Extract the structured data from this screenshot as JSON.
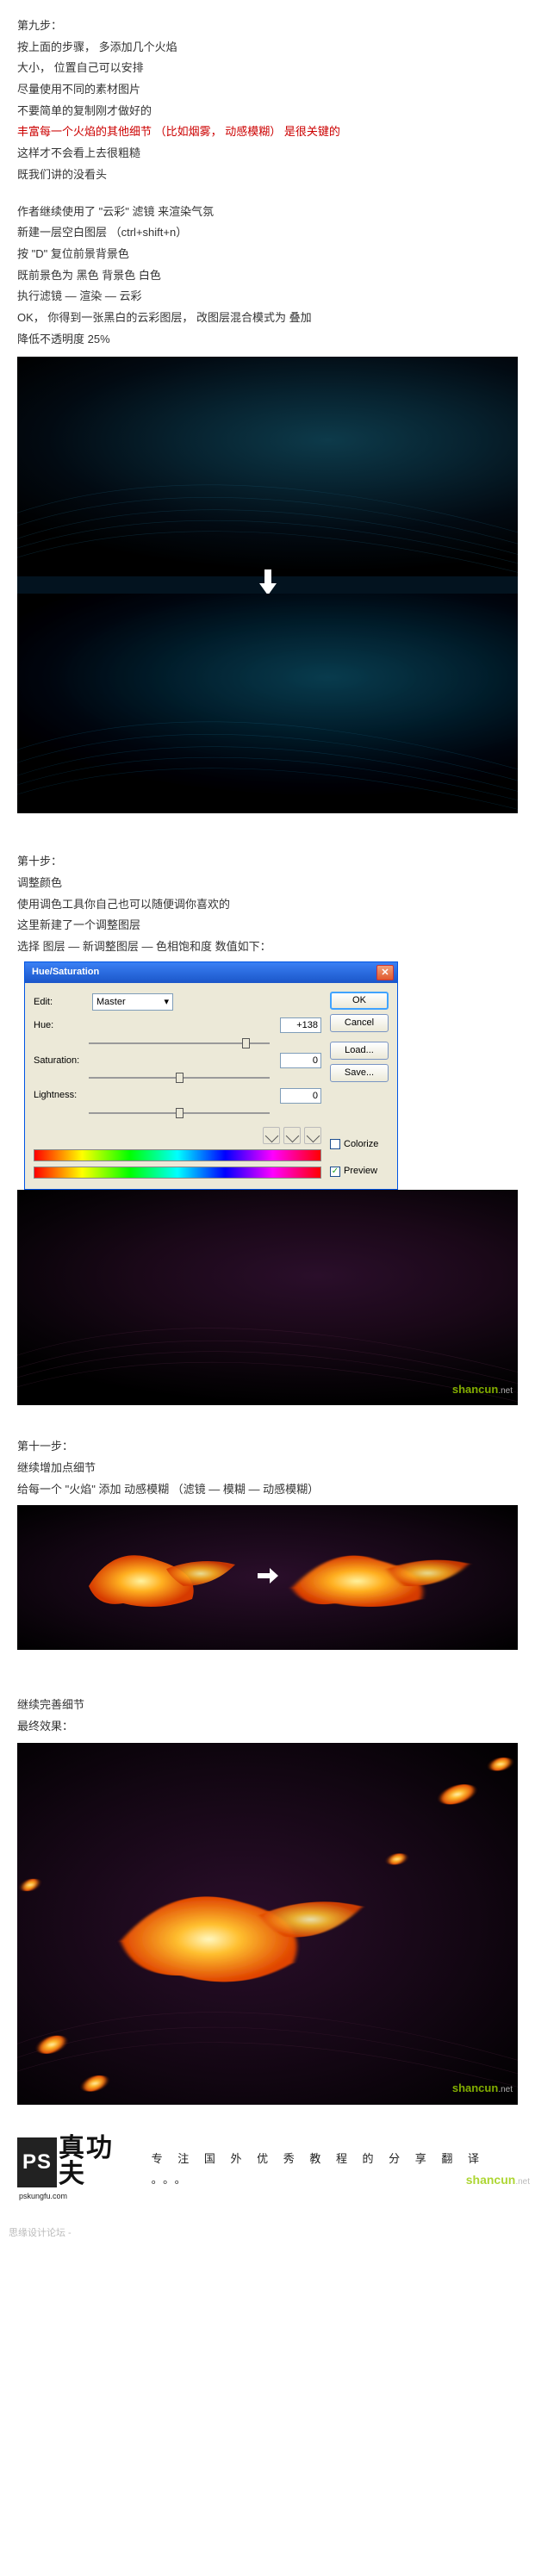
{
  "sections": {
    "step9": {
      "title": "第九步：",
      "l1": "按上面的步骤， 多添加几个火焰",
      "l2": "大小， 位置自己可以安排",
      "l3": "尽量使用不同的素材图片",
      "l4": "不要简单的复制刚才做好的",
      "l5a": "丰富每一个火焰的其他细节 （比如烟雾， 动感模糊） 是很关键的",
      "l6": "这样才不会看上去很粗糙",
      "l7": "既我们讲的没看头",
      "l8": "作者继续使用了 \"云彩\" 滤镜 来渲染气氛",
      "l9": "新建一层空白图层 （ctrl+shift+n）",
      "l10": "按 \"D\" 复位前景背景色",
      "l11": "既前景色为 黑色  背景色 白色",
      "l12": "执行滤镜 — 渲染 — 云彩",
      "l13": "OK， 你得到一张黑白的云彩图层， 改图层混合模式为  叠加",
      "l14": "降低不透明度 25%"
    },
    "step10": {
      "title": "第十步：",
      "l1": "调整颜色",
      "l2": "使用调色工具你自己也可以随便调你喜欢的",
      "l3": "这里新建了一个调整图层",
      "l4": "选择 图层 — 新调整图层 — 色相饱和度  数值如下："
    },
    "step11": {
      "title": "第十一步：",
      "l1": "继续增加点细节",
      "l2": "给每一个 \"火焰\" 添加 动感模糊 （滤镜 — 模糊 — 动感模糊）",
      "final1": "继续完善细节",
      "final2": "最终效果："
    }
  },
  "dialog": {
    "title": "Hue/Saturation",
    "edit_label": "Edit:",
    "master": "Master",
    "hue_label": "Hue:",
    "hue_val": "+138",
    "sat_label": "Saturation:",
    "sat_val": "0",
    "light_label": "Lightness:",
    "light_val": "0",
    "ok": "OK",
    "cancel": "Cancel",
    "load": "Load...",
    "save": "Save...",
    "colorize": "Colorize",
    "preview": "Preview"
  },
  "footer": {
    "logo_ps": "PS",
    "logo_zh": "真功夫",
    "logo_url": "pskungfu.com",
    "tagline": "专 注 国 外 优 秀 教 程 的 分 享 翻 译 。。。",
    "watermark": "shancun",
    "watermark_suffix": ".net",
    "subfooter": "思缘设计论坛 -"
  },
  "icons": {
    "arrow_down": "⬇",
    "arrow_right": "➔",
    "dropdown": "▾",
    "check": "✓",
    "close": "✕"
  }
}
